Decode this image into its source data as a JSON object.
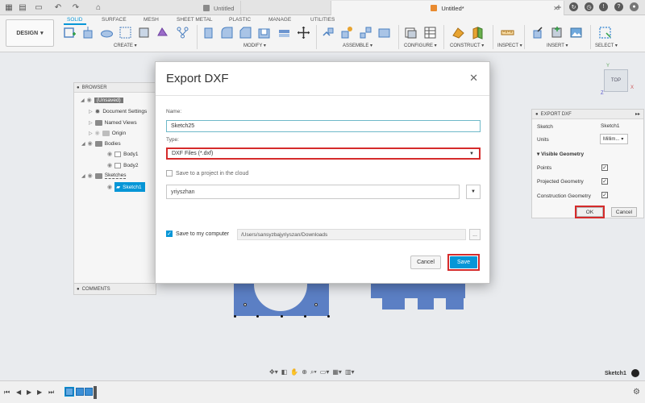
{
  "app": {
    "tabs": [
      {
        "label": "Untitled",
        "active": false
      },
      {
        "label": "Untitled*",
        "active": true
      }
    ]
  },
  "toolbar": {
    "workspace_button": "DESIGN",
    "workspace_tabs": [
      "SOLID",
      "SURFACE",
      "MESH",
      "SHEET METAL",
      "PLASTIC",
      "MANAGE",
      "UTILITIES"
    ],
    "active_tab": "SOLID",
    "groups": [
      "CREATE",
      "MODIFY",
      "ASSEMBLE",
      "CONFIGURE",
      "CONSTRUCT",
      "INSPECT",
      "INSERT",
      "SELECT"
    ]
  },
  "browser": {
    "header": "BROWSER",
    "items": [
      {
        "label": "(Unsaved)"
      },
      {
        "label": "Document Settings"
      },
      {
        "label": "Named Views"
      },
      {
        "label": "Origin"
      },
      {
        "label": "Bodies"
      },
      {
        "label": "Body1"
      },
      {
        "label": "Body2"
      },
      {
        "label": "Sketches"
      },
      {
        "label": "Sketch1"
      }
    ],
    "comments": "COMMENTS"
  },
  "dialog": {
    "title": "Export DXF",
    "name_label": "Name:",
    "name_value": "Sketch25",
    "type_label": "Type:",
    "type_value": "DXF Files (*.dxf)",
    "cloud_label": "Save to a project in the cloud",
    "project_value": "yriyszhan",
    "computer_label": "Save to my computer",
    "path_value": "/Users/sansyzbajyriyszan/Downloads",
    "path_button": "...",
    "cancel": "Cancel",
    "save": "Save"
  },
  "export_panel": {
    "title": "EXPORT DXF",
    "sketch_label": "Sketch",
    "sketch_value": "Sketch1",
    "units_label": "Units",
    "units_value": "Millim...",
    "visible_geometry": "Visible Geometry",
    "options": [
      {
        "label": "Points",
        "checked": true
      },
      {
        "label": "Projected Geometry",
        "checked": true
      },
      {
        "label": "Construction Geometry",
        "checked": true
      }
    ],
    "ok": "OK",
    "cancel": "Cancel"
  },
  "viewcube": {
    "face": "TOP",
    "x": "X",
    "y": "Y",
    "z": "Z"
  },
  "status": {
    "sketch": "Sketch1"
  }
}
